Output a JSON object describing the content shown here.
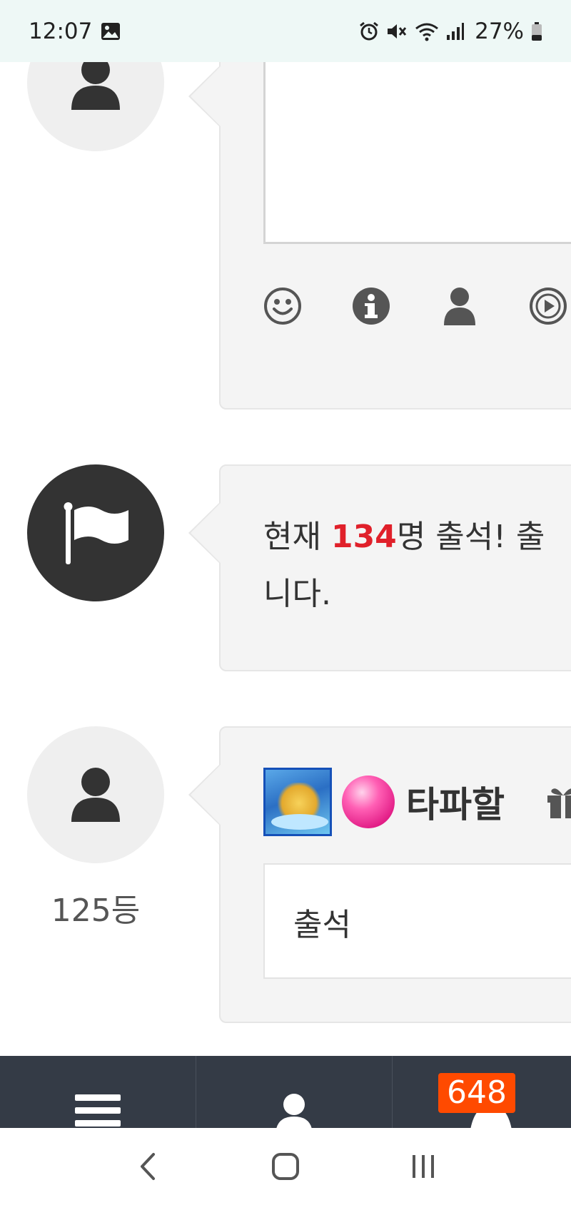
{
  "status_bar": {
    "time": "12:07",
    "battery_percent": "27%",
    "icons": [
      "image-icon",
      "alarm-icon",
      "mute-icon",
      "wifi-icon",
      "signal-icon",
      "battery-icon"
    ]
  },
  "compose": {
    "tools": [
      "emoji-icon",
      "info-icon",
      "user-icon",
      "play-icon"
    ]
  },
  "notice": {
    "prefix": "현재 ",
    "count": "134",
    "suffix_line1": "명 출석! 출",
    "line2": "니다."
  },
  "entry": {
    "rank": "125등",
    "username": "타파할",
    "comment": "출석"
  },
  "app_nav": {
    "badge_count": "648",
    "items": [
      "menu-icon",
      "user-icon",
      "notification-icon"
    ]
  },
  "colors": {
    "accent_count": "#e0202a",
    "badge": "#ff4a00",
    "nav_bg": "#343b46",
    "status_bg": "#eef8f6"
  }
}
